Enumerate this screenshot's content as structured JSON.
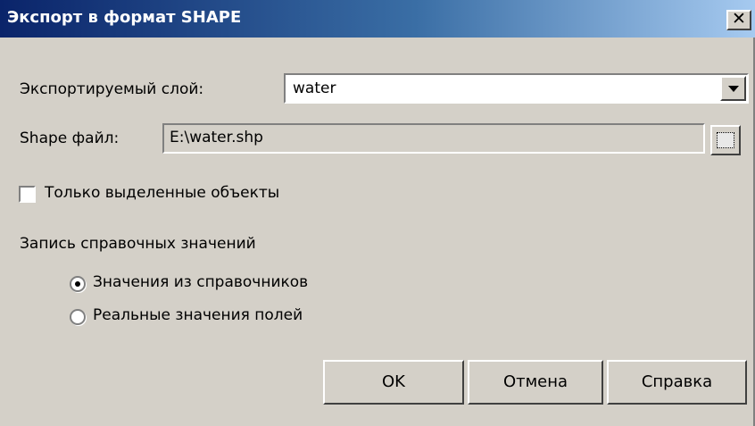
{
  "window": {
    "title": "Экспорт в формат SHAPE",
    "close_label": "✕"
  },
  "layer": {
    "label": "Экспортируемый слой:",
    "value": "water",
    "dropdown_icon": "chevron-down-icon"
  },
  "shape_file": {
    "label": "Shape файл:",
    "value": "E:\\water.shp",
    "browse_icon": "folder-browse-icon"
  },
  "selected_only": {
    "label": "Только выделенные объекты",
    "checked": false
  },
  "reference_values": {
    "group_label": "Запись справочных значений",
    "options": [
      {
        "label": "Значения из справочников",
        "selected": true
      },
      {
        "label": "Реальные значения полей",
        "selected": false
      }
    ]
  },
  "buttons": {
    "ok": "OK",
    "cancel": "Отмена",
    "help": "Справка"
  },
  "colors": {
    "dialog_bg": "#d4d0c8",
    "title_start": "#0a246a",
    "title_end": "#a6caf0"
  }
}
